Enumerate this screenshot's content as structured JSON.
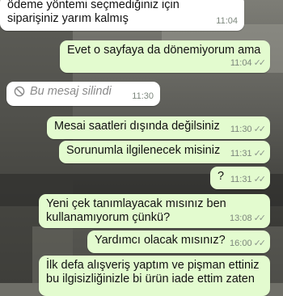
{
  "chat": {
    "messages": [
      {
        "text": "ödeme yöntemi seçmediğiniz için siparişiniz yarım kalmış",
        "time": "11:04",
        "direction": "incoming"
      },
      {
        "text": "Evet o sayfaya da dönemiyorum ama",
        "time": "11:04",
        "direction": "outgoing"
      },
      {
        "text": "Bu mesaj silindi",
        "time": "11:30",
        "direction": "incoming",
        "deleted": true
      },
      {
        "text": "Mesai saatleri dışında değilsiniz",
        "time": "11:30",
        "direction": "outgoing"
      },
      {
        "text": "Sorunumla ilgilenecek misiniz",
        "time": "11:31",
        "direction": "outgoing"
      },
      {
        "text": "?",
        "time": "11:31",
        "direction": "outgoing"
      },
      {
        "text": "Yeni çek tanımlayacak mısınız ben kullanamıyorum çünkü?",
        "time": "13:08",
        "direction": "outgoing"
      },
      {
        "text": "Yardımcı olacak mısınız?",
        "time": "16:00",
        "direction": "outgoing"
      },
      {
        "text": "İlk defa alışveriş yaptım ve pişman ettiniz bu ilgisizliğinizle bi ürün iade ettim zaten",
        "direction": "outgoing"
      }
    ]
  },
  "colors": {
    "incoming_bubble": "#ffffff",
    "outgoing_bubble": "#e3fbcf",
    "meta_text": "#7d877d"
  },
  "icons": {
    "deleted": "ban-icon",
    "delivered": "double-check-icon"
  }
}
